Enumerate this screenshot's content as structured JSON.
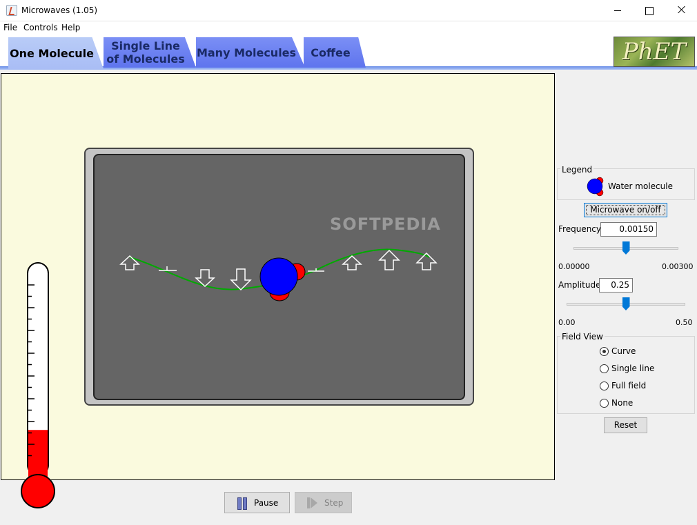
{
  "window": {
    "title": "Microwaves (1.05)",
    "icon": "java-cup-icon"
  },
  "menu": [
    "File",
    "Controls",
    "Help"
  ],
  "tabs": [
    {
      "label": "One Molecule",
      "active": true
    },
    {
      "label": "Single Line\nof Molecules",
      "active": false
    },
    {
      "label": "Many Molecules",
      "active": false
    },
    {
      "label": "Coffee",
      "active": false
    }
  ],
  "logo": "PhET",
  "watermark": "SOFTPEDIA",
  "thermometer": {
    "fill_fraction": 0.22,
    "color": "#ff0000"
  },
  "legend": {
    "title": "Legend",
    "item_label": "Water molecule"
  },
  "controls": {
    "microwave_button": "Microwave on/off",
    "frequency": {
      "label": "Frequency",
      "value": "0.00150",
      "min_label": "0.00000",
      "max_label": "0.00300",
      "fraction": 0.5
    },
    "amplitude": {
      "label": "Amplitude",
      "value": "0.25",
      "min_label": "0.00",
      "max_label": "0.50",
      "fraction": 0.5
    },
    "field_view": {
      "title": "Field View",
      "options": [
        {
          "label": "Curve",
          "checked": true
        },
        {
          "label": "Single line",
          "checked": false
        },
        {
          "label": "Full field",
          "checked": false
        },
        {
          "label": "None",
          "checked": false
        }
      ]
    },
    "reset_label": "Reset"
  },
  "playback": {
    "pause_label": "Pause",
    "step_label": "Step",
    "step_enabled": false
  },
  "colors": {
    "molecule_oxygen": "#0000ff",
    "molecule_hydrogen": "#ff0000",
    "field_curve": "#00aa00",
    "sim_background": "#fafade",
    "oven_inner": "#656565",
    "tab_active": "#b2c6f6",
    "tab_inactive": "#6f84f2"
  }
}
